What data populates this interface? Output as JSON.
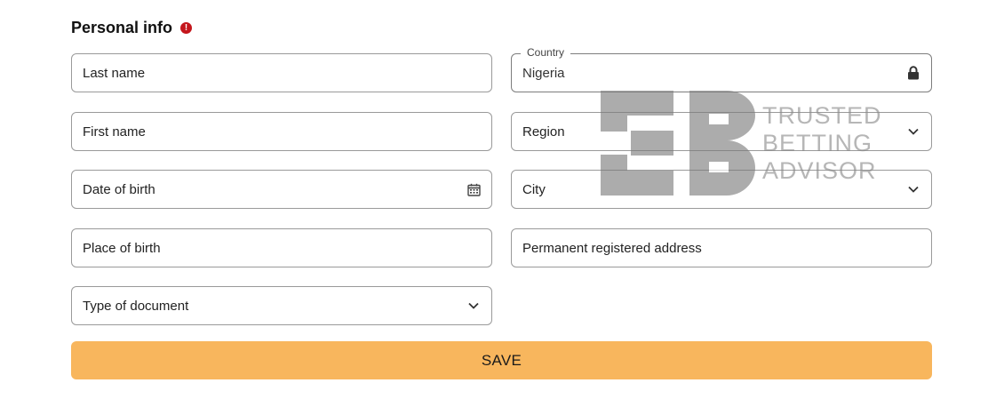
{
  "section": {
    "title": "Personal info",
    "alert_icon": "exclamation-circle-icon",
    "alert_color": "#c4161c",
    "alert_glyph": "!"
  },
  "form": {
    "last_name": {
      "label": "Last name"
    },
    "first_name": {
      "label": "First name"
    },
    "date_of_birth": {
      "label": "Date of birth",
      "icon": "calendar-icon"
    },
    "place_of_birth": {
      "label": "Place of birth"
    },
    "document_type": {
      "label": "Type of document",
      "icon": "chevron-down-icon"
    },
    "country": {
      "label": "Country",
      "value": "Nigeria",
      "icon": "lock-icon"
    },
    "region": {
      "label": "Region",
      "icon": "chevron-down-icon"
    },
    "city": {
      "label": "City",
      "icon": "chevron-down-icon"
    },
    "address": {
      "label": "Permanent registered address"
    }
  },
  "save_button": {
    "label": "SAVE",
    "color": "#f8b65d"
  },
  "watermark": {
    "lines": [
      "TRUSTED",
      "BETTING",
      "ADVISOR"
    ],
    "color": "#8a8a8a"
  }
}
